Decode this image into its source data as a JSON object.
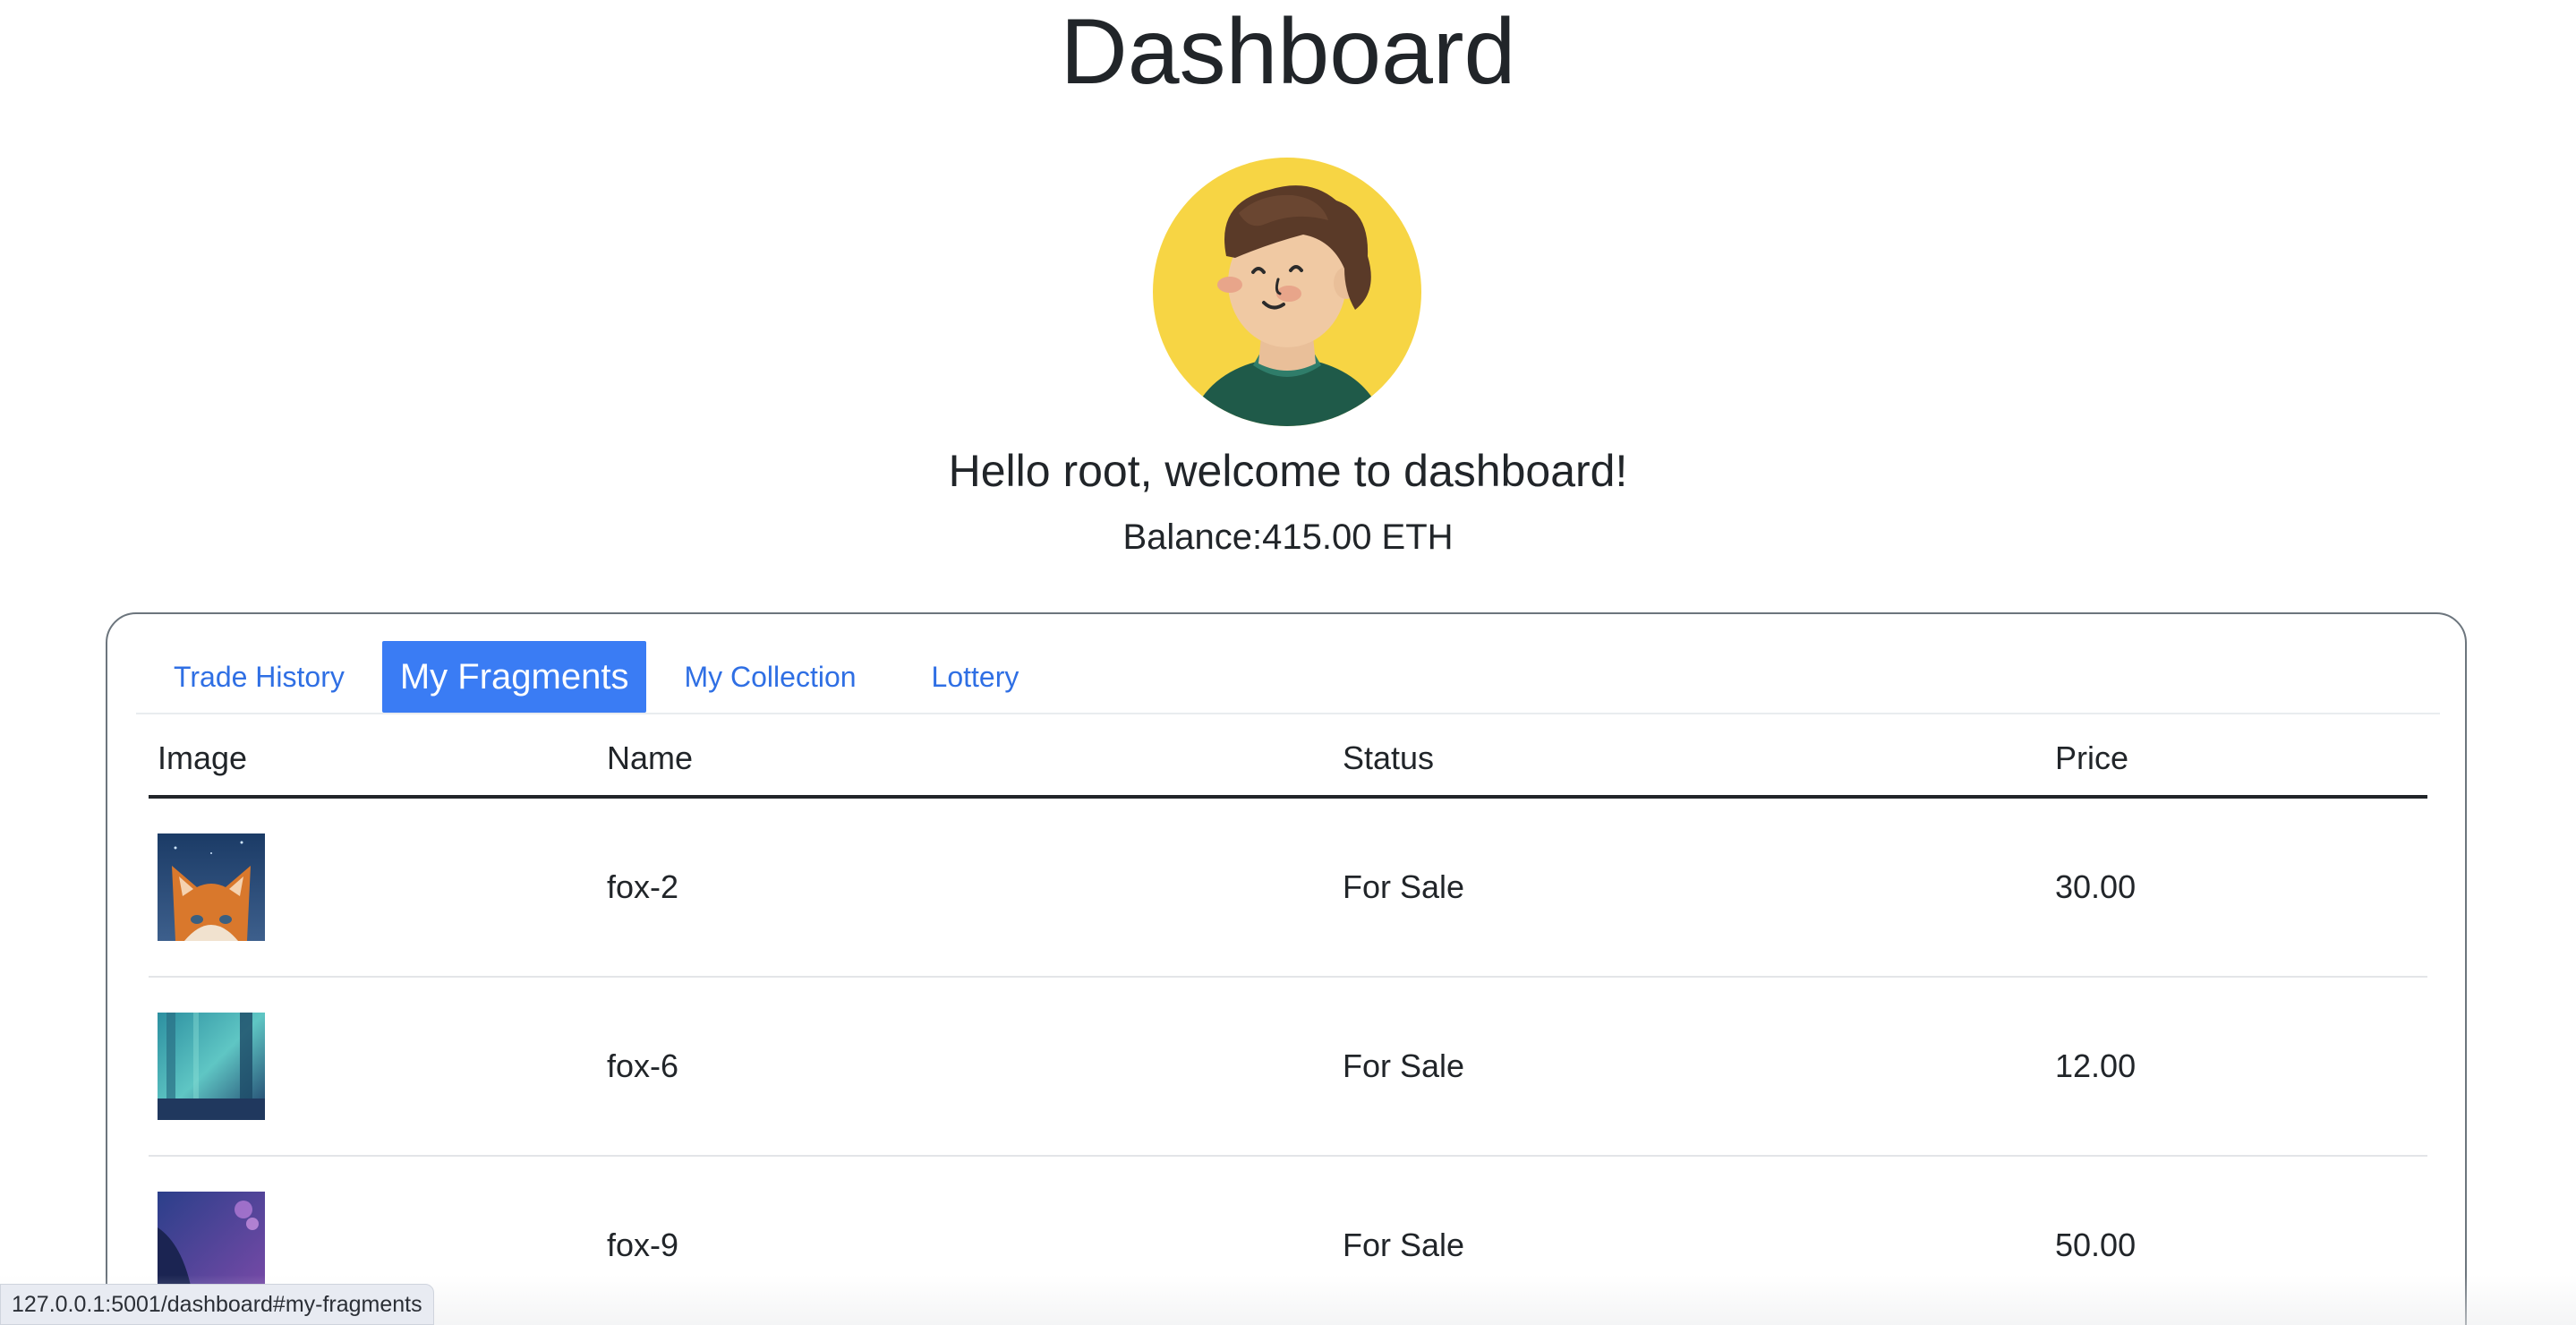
{
  "page": {
    "title": "Dashboard",
    "welcome": "Hello root, welcome to dashboard!",
    "balance": "Balance:415.00 ETH"
  },
  "avatar": {
    "icon": "avatar-icon",
    "background_color": "#f7d544"
  },
  "tabs": [
    {
      "label": "Trade History",
      "active": false
    },
    {
      "label": "My Fragments",
      "active": true
    },
    {
      "label": "My Collection",
      "active": false
    },
    {
      "label": "Lottery",
      "active": false
    }
  ],
  "table": {
    "headers": [
      "Image",
      "Name",
      "Status",
      "Price"
    ],
    "rows": [
      {
        "image": "fox-2 thumbnail",
        "name": "fox-2",
        "status": "For Sale",
        "price": "30.00"
      },
      {
        "image": "fox-6 thumbnail",
        "name": "fox-6",
        "status": "For Sale",
        "price": "12.00"
      },
      {
        "image": "fox-9 thumbnail",
        "name": "fox-9",
        "status": "For Sale",
        "price": "50.00"
      }
    ]
  },
  "status_bar": {
    "url": "127.0.0.1:5001/dashboard#my-fragments"
  },
  "colors": {
    "accent": "#3a7cf4",
    "link": "#2f6fe4",
    "text": "#212529"
  }
}
